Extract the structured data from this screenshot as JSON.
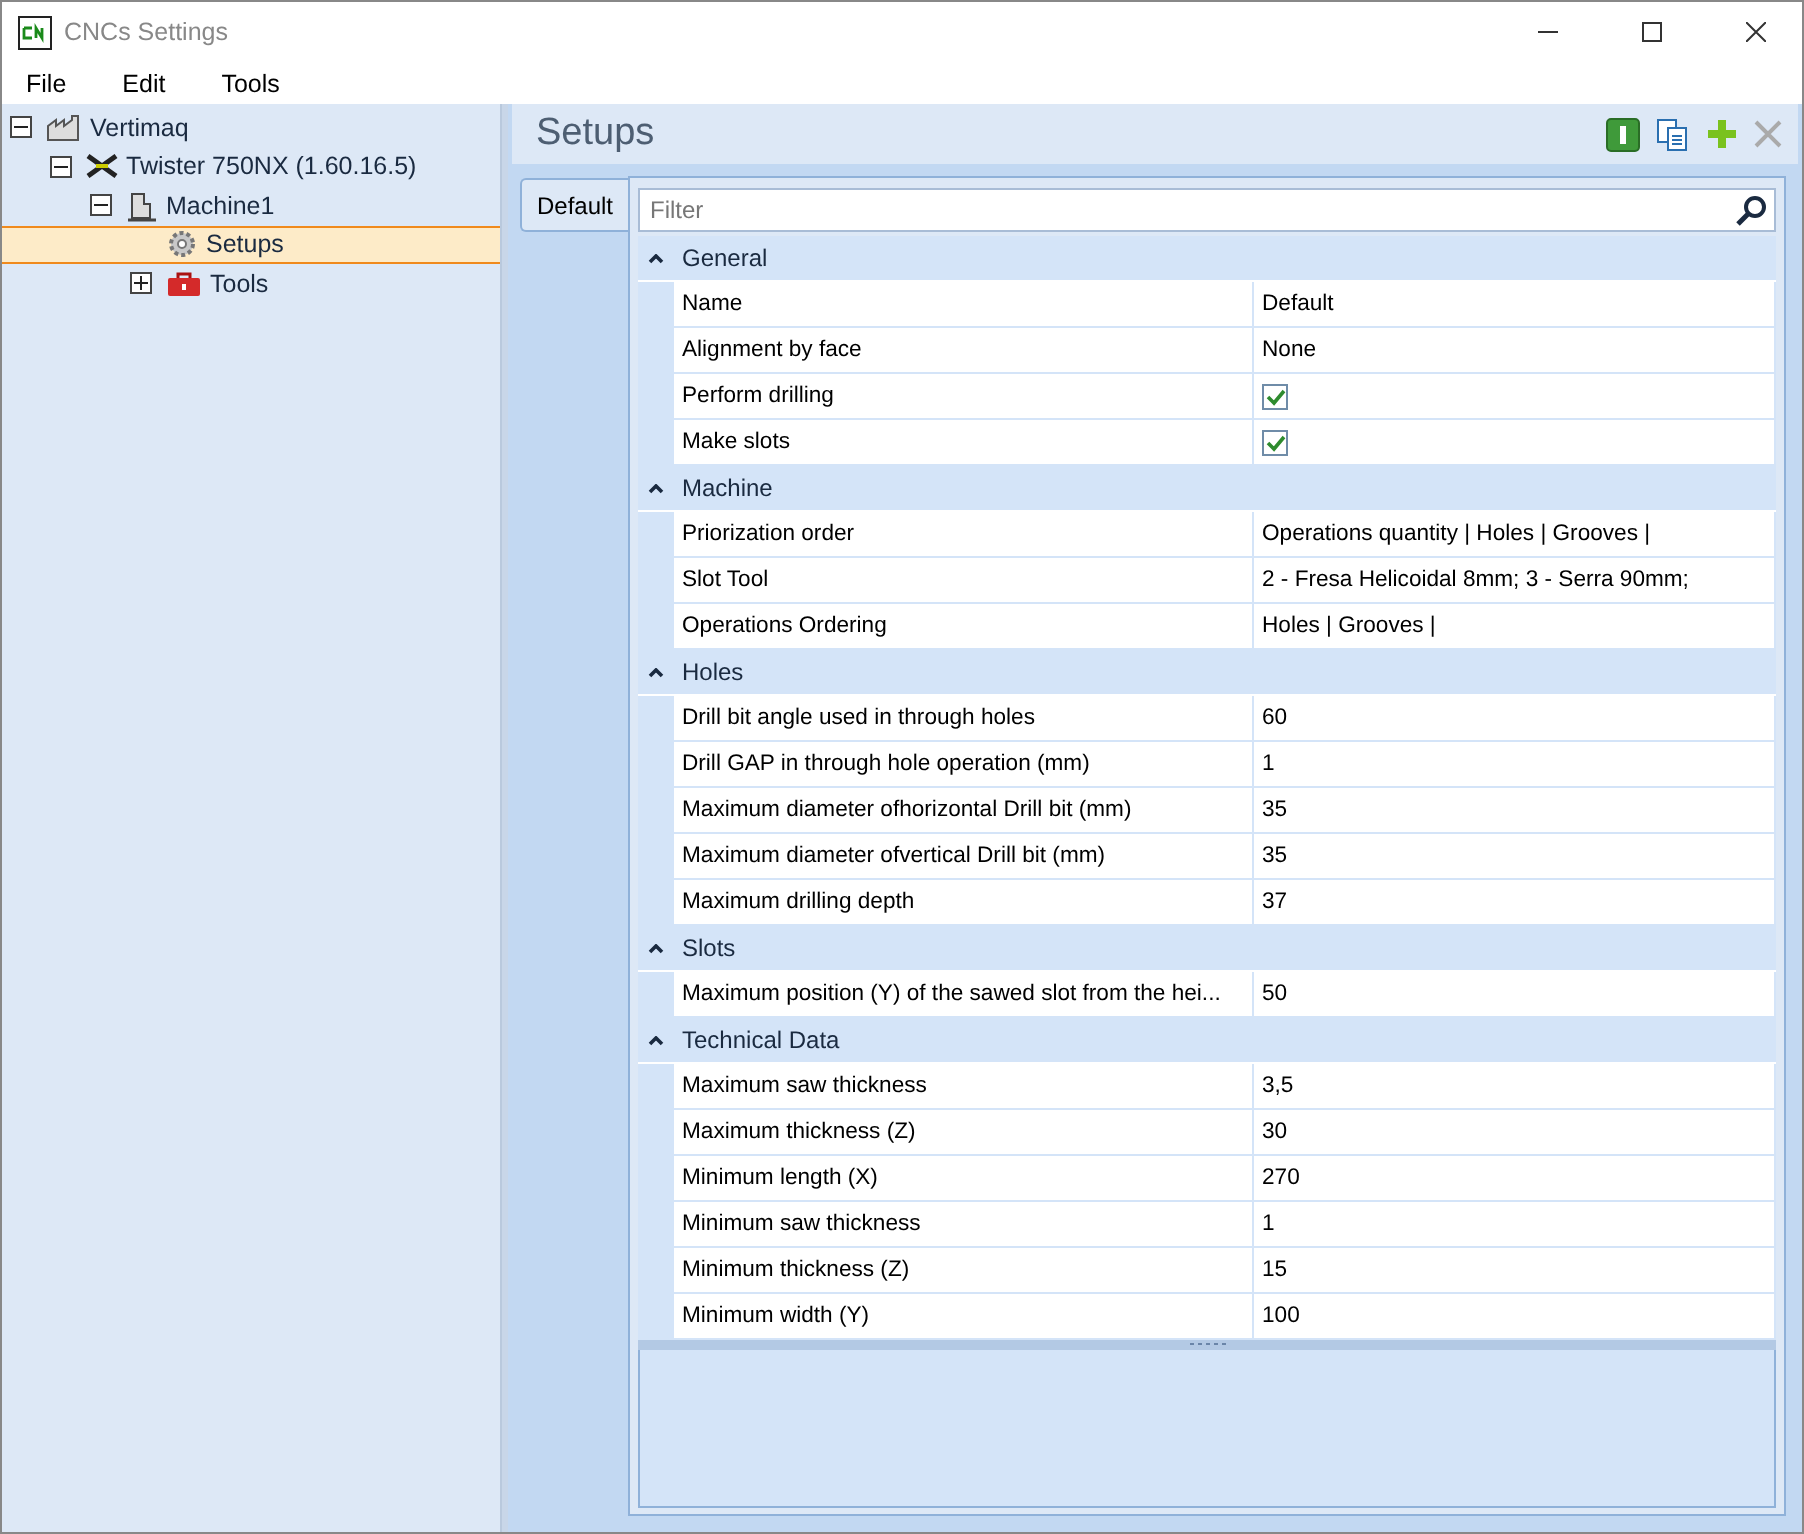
{
  "window": {
    "title": "CNCs Settings"
  },
  "menu": [
    "File",
    "Edit",
    "Tools"
  ],
  "tree": [
    {
      "label": "Vertimaq",
      "kind": "factory",
      "expanded": true,
      "selected": false,
      "children": [
        {
          "label": "Twister 750NX (1.60.16.5)",
          "kind": "machine-x",
          "expanded": true,
          "selected": false,
          "children": [
            {
              "label": "Machine1",
              "kind": "machine",
              "expanded": true,
              "selected": false,
              "children": [
                {
                  "label": "Setups",
                  "kind": "gear",
                  "selected": true
                },
                {
                  "label": "Tools",
                  "kind": "toolbox",
                  "expanded": false,
                  "selected": false
                }
              ]
            }
          ]
        }
      ]
    }
  ],
  "panel": {
    "title": "Setups",
    "tabs": [
      {
        "label": "Default",
        "selected": true
      }
    ],
    "filter": {
      "placeholder": "Filter"
    },
    "categories": [
      {
        "name": "General",
        "expanded": true,
        "rows": [
          {
            "kind": "text",
            "name": "Name",
            "value": "Default"
          },
          {
            "kind": "text",
            "name": "Alignment by face",
            "value": "None"
          },
          {
            "kind": "checkbox",
            "name": "Perform drilling",
            "checked": true
          },
          {
            "kind": "checkbox",
            "name": "Make slots",
            "checked": true
          }
        ]
      },
      {
        "name": "Machine",
        "expanded": true,
        "rows": [
          {
            "kind": "text",
            "name": "Priorization order",
            "value": "Operations quantity | Holes | Grooves |"
          },
          {
            "kind": "text",
            "name": "Slot Tool",
            "value": "2 - Fresa Helicoidal 8mm; 3 - Serra 90mm;"
          },
          {
            "kind": "text",
            "name": "Operations Ordering",
            "value": "Holes | Grooves |"
          }
        ]
      },
      {
        "name": "Holes",
        "expanded": true,
        "rows": [
          {
            "kind": "text",
            "name": "Drill bit angle used in through holes",
            "value": "60"
          },
          {
            "kind": "text",
            "name": "Drill GAP in through hole operation (mm)",
            "value": "1"
          },
          {
            "kind": "text",
            "name": "Maximum diameter ofhorizontal Drill bit (mm)",
            "value": "35"
          },
          {
            "kind": "text",
            "name": "Maximum diameter ofvertical Drill bit (mm)",
            "value": "35"
          },
          {
            "kind": "text",
            "name": "Maximum drilling depth",
            "value": "37"
          }
        ]
      },
      {
        "name": "Slots",
        "expanded": true,
        "rows": [
          {
            "kind": "text",
            "name": "Maximum position (Y) of the sawed slot from the hei...",
            "value": "50"
          }
        ]
      },
      {
        "name": "Technical Data",
        "expanded": true,
        "rows": [
          {
            "kind": "text",
            "name": "Maximum saw thickness",
            "value": "3,5"
          },
          {
            "kind": "text",
            "name": "Maximum thickness (Z)",
            "value": "30"
          },
          {
            "kind": "text",
            "name": "Minimum length (X)",
            "value": "270"
          },
          {
            "kind": "text",
            "name": "Minimum saw thickness",
            "value": "1"
          },
          {
            "kind": "text",
            "name": "Minimum thickness (Z)",
            "value": "15"
          },
          {
            "kind": "text",
            "name": "Minimum width (Y)",
            "value": "100"
          }
        ]
      }
    ]
  }
}
